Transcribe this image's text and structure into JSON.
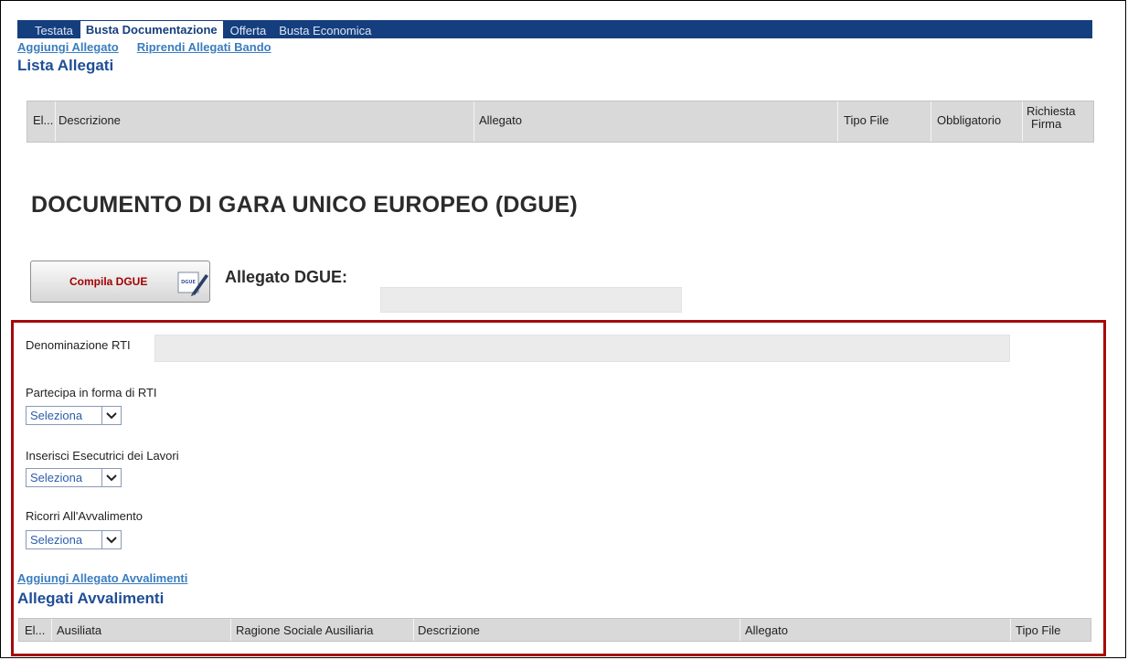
{
  "tabs": [
    {
      "label": "Testata",
      "active": false
    },
    {
      "label": "Busta Documentazione",
      "active": true
    },
    {
      "label": "Offerta",
      "active": false
    },
    {
      "label": "Busta Economica",
      "active": false
    }
  ],
  "top_links": {
    "aggiungi_allegato": "Aggiungi Allegato",
    "riprendi_allegati_bando": "Riprendi Allegati Bando"
  },
  "lista_allegati": {
    "title": "Lista Allegati",
    "columns": [
      "El...",
      "Descrizione",
      "Allegato",
      "Tipo File",
      "Obbligatorio",
      "Richiesta",
      "Firma"
    ]
  },
  "dgue": {
    "title": "DOCUMENTO DI GARA UNICO EUROPEO (DGUE)",
    "button_label": "Compila DGUE",
    "icon_text": "DGUE",
    "allegato_label": "Allegato DGUE:",
    "allegato_value": ""
  },
  "rti": {
    "denominazione_label": "Denominazione RTI",
    "denominazione_value": "",
    "partecipa_label": "Partecipa in forma di RTI",
    "partecipa_value": "Seleziona",
    "esecutrici_label": "Inserisci Esecutrici dei Lavori",
    "esecutrici_value": "Seleziona",
    "avvalimento_label": "Ricorri All'Avvalimento",
    "avvalimento_value": "Seleziona"
  },
  "avvalimenti": {
    "add_link": "Aggiungi Allegato Avvalimenti",
    "title": "Allegati Avvalimenti",
    "columns": [
      "El...",
      "Ausiliata",
      "Ragione Sociale Ausiliaria",
      "Descrizione",
      "Allegato",
      "Tipo File"
    ]
  },
  "colors": {
    "tabbar": "#153e7e",
    "link": "#3a7dbf",
    "section_title": "#1f4e96",
    "highlight_border": "#a50a0a",
    "button_text": "#a30000"
  }
}
